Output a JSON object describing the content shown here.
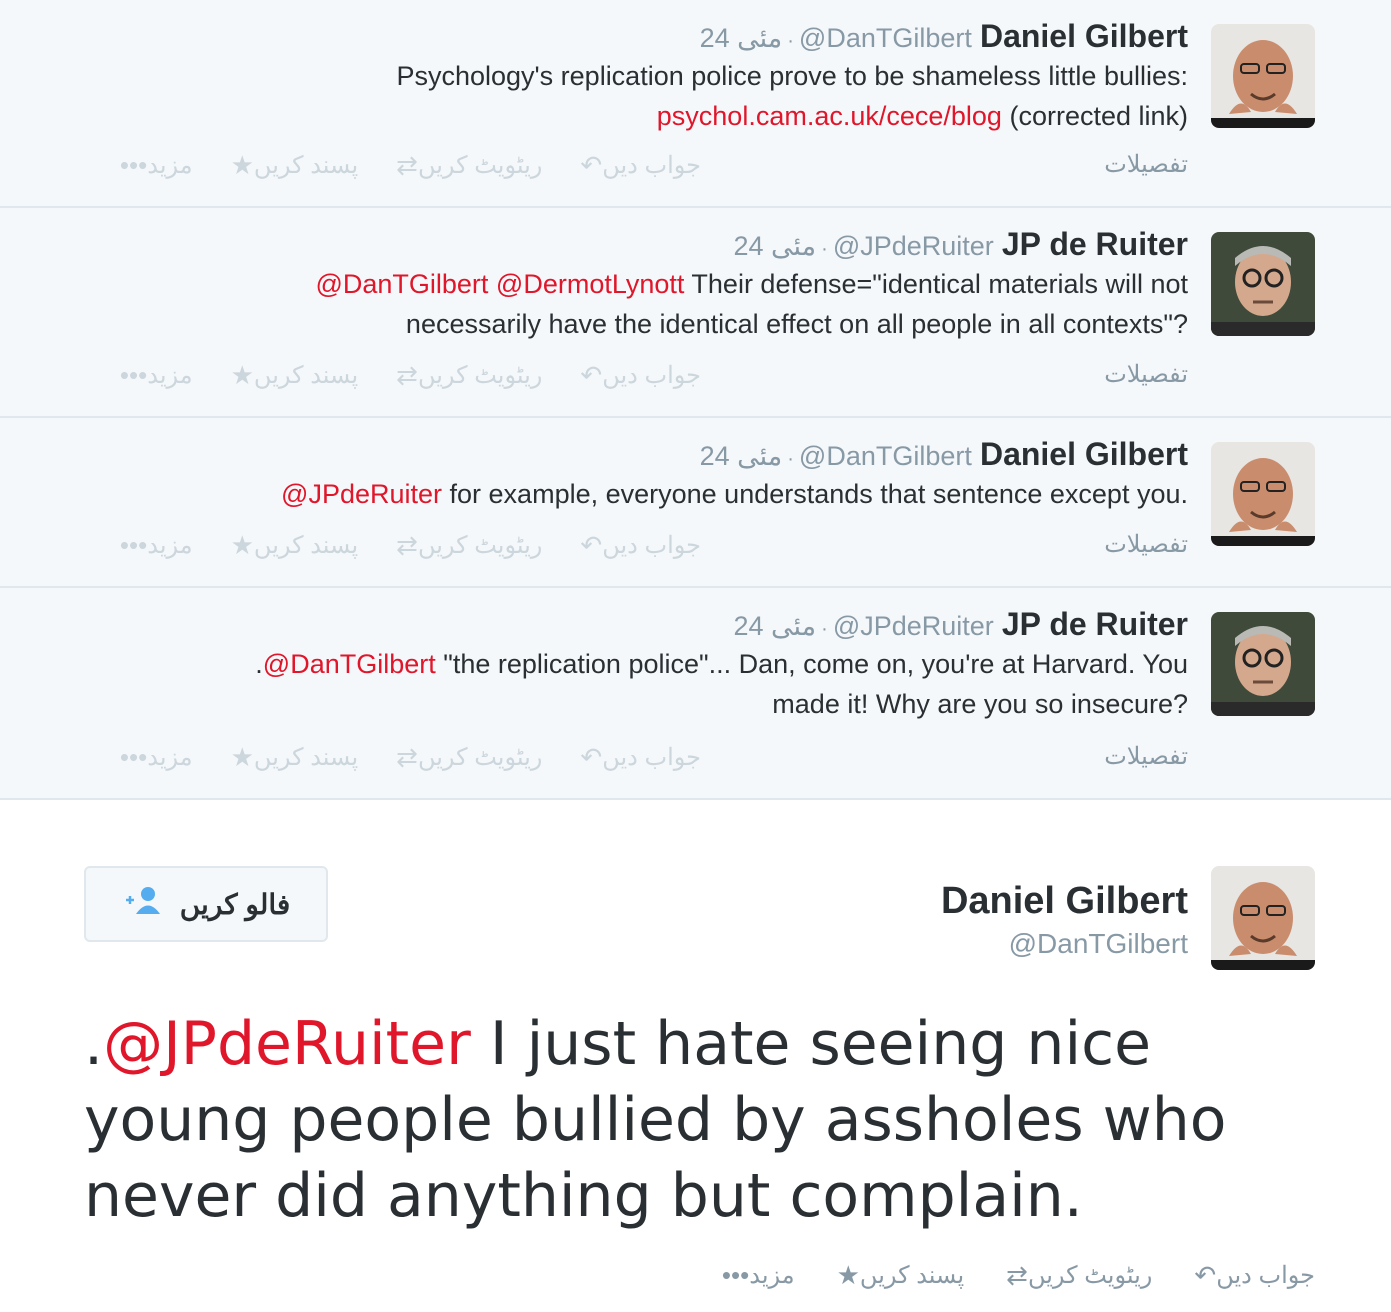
{
  "tweets": [
    {
      "name": "Daniel Gilbert",
      "handle": "@DanTGilbert",
      "time": "24 مئی",
      "lines": [
        {
          "parts": [
            {
              "t": "Psychology's replication police prove to be shameless little bullies:",
              "link": false
            }
          ]
        },
        {
          "parts": [
            {
              "t": "psychol.cam.ac.uk/cece/blog",
              "link": true
            },
            {
              "t": " (corrected link)",
              "link": false
            }
          ]
        }
      ],
      "details": "تفصیلات",
      "avatar": "gilbert"
    },
    {
      "name": "JP de Ruiter",
      "handle": "@JPdeRuiter",
      "time": "24 مئی",
      "lines": [
        {
          "parts": [
            {
              "t": "@DanTGilbert",
              "link": true
            },
            {
              "t": " ",
              "link": false
            },
            {
              "t": "@DermotLynott",
              "link": true
            },
            {
              "t": " Their defense=\"identical materials will not",
              "link": false
            }
          ]
        },
        {
          "parts": [
            {
              "t": "necessarily have the identical effect on all people in all contexts\"?",
              "link": false
            }
          ]
        }
      ],
      "details": "تفصیلات",
      "avatar": "ruiter"
    },
    {
      "name": "Daniel Gilbert",
      "handle": "@DanTGilbert",
      "time": "24 مئی",
      "lines": [
        {
          "parts": [
            {
              "t": "@JPdeRuiter",
              "link": true
            },
            {
              "t": " for example, everyone understands that sentence except you.",
              "link": false
            }
          ]
        }
      ],
      "details": "تفصیلات",
      "avatar": "gilbert"
    },
    {
      "name": "JP de Ruiter",
      "handle": "@JPdeRuiter",
      "time": "24 مئی",
      "lines": [
        {
          "parts": [
            {
              "t": ".",
              "link": false
            },
            {
              "t": "@DanTGilbert",
              "link": true
            },
            {
              "t": " \"the replication police\"... Dan, come on, you're at Harvard. You",
              "link": false
            }
          ]
        },
        {
          "parts": [
            {
              "t": "made it! Why are you so insecure?",
              "link": false
            }
          ]
        }
      ],
      "details": "تفصیلات",
      "avatar": "ruiter"
    }
  ],
  "actions": {
    "reply": "جواب دیں",
    "retweet": "ریٹویٹ کریں",
    "favorite": "پسند کریں",
    "more": "مزید"
  },
  "main": {
    "name": "Daniel Gilbert",
    "handle": "@DanTGilbert",
    "follow_label": "فالو کریں",
    "text_prefix": ".",
    "text_mention": "@JPdeRuiter",
    "text_rest": " I just hate seeing nice young people bullied by assholes who never did anything but complain."
  },
  "icons": {
    "reply": "reply-icon",
    "retweet": "retweet-icon",
    "favorite": "star-icon",
    "more": "more-dots-icon",
    "follow": "add-user-icon"
  },
  "colors": {
    "link": "#e0162b",
    "muted": "#8899a6",
    "faint": "#ccd6dd",
    "background": "#f5f8fa",
    "follow_icon": "#55acee"
  }
}
